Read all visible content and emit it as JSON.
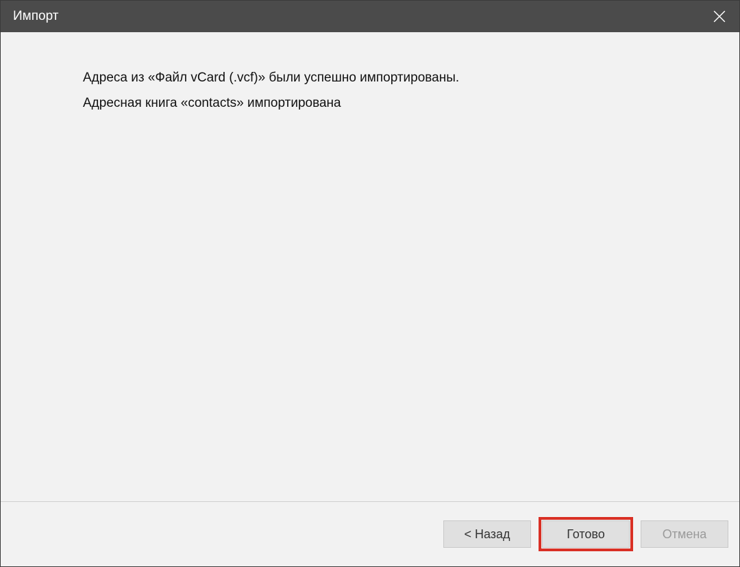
{
  "titlebar": {
    "title": "Импорт"
  },
  "content": {
    "line1": "Адреса из «Файл vCard (.vcf)» были успешно импортированы.",
    "line2": "Адресная книга «contacts» импортирована"
  },
  "footer": {
    "back_label": "< Назад",
    "done_label": "Готово",
    "cancel_label": "Отмена"
  }
}
